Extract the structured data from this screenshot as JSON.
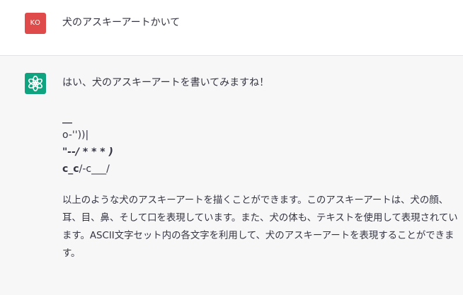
{
  "user_message": {
    "avatar_initials": "KO",
    "text": "犬のアスキーアートかいて"
  },
  "assistant_message": {
    "intro": "はい、犬のアスキーアートを書いてみますね！",
    "ascii_art": {
      "line1": "__",
      "line2": "o-''))|",
      "line3": "\"--/ * * * )",
      "line4_bold": "c_c",
      "line4_rest": "/-c___/"
    },
    "explanation": "以上のような犬のアスキーアートを描くことができます。このアスキーアートは、犬の顔、耳、目、鼻、そして口を表現しています。また、犬の体も、テキストを使用して表現されています。ASCII文字セット内の各文字を利用して、犬のアスキーアートを表現することができます。"
  },
  "colors": {
    "user_avatar": "#df4b4b",
    "assistant_avatar": "#10a37f",
    "assistant_bg": "#f7f7f8"
  }
}
